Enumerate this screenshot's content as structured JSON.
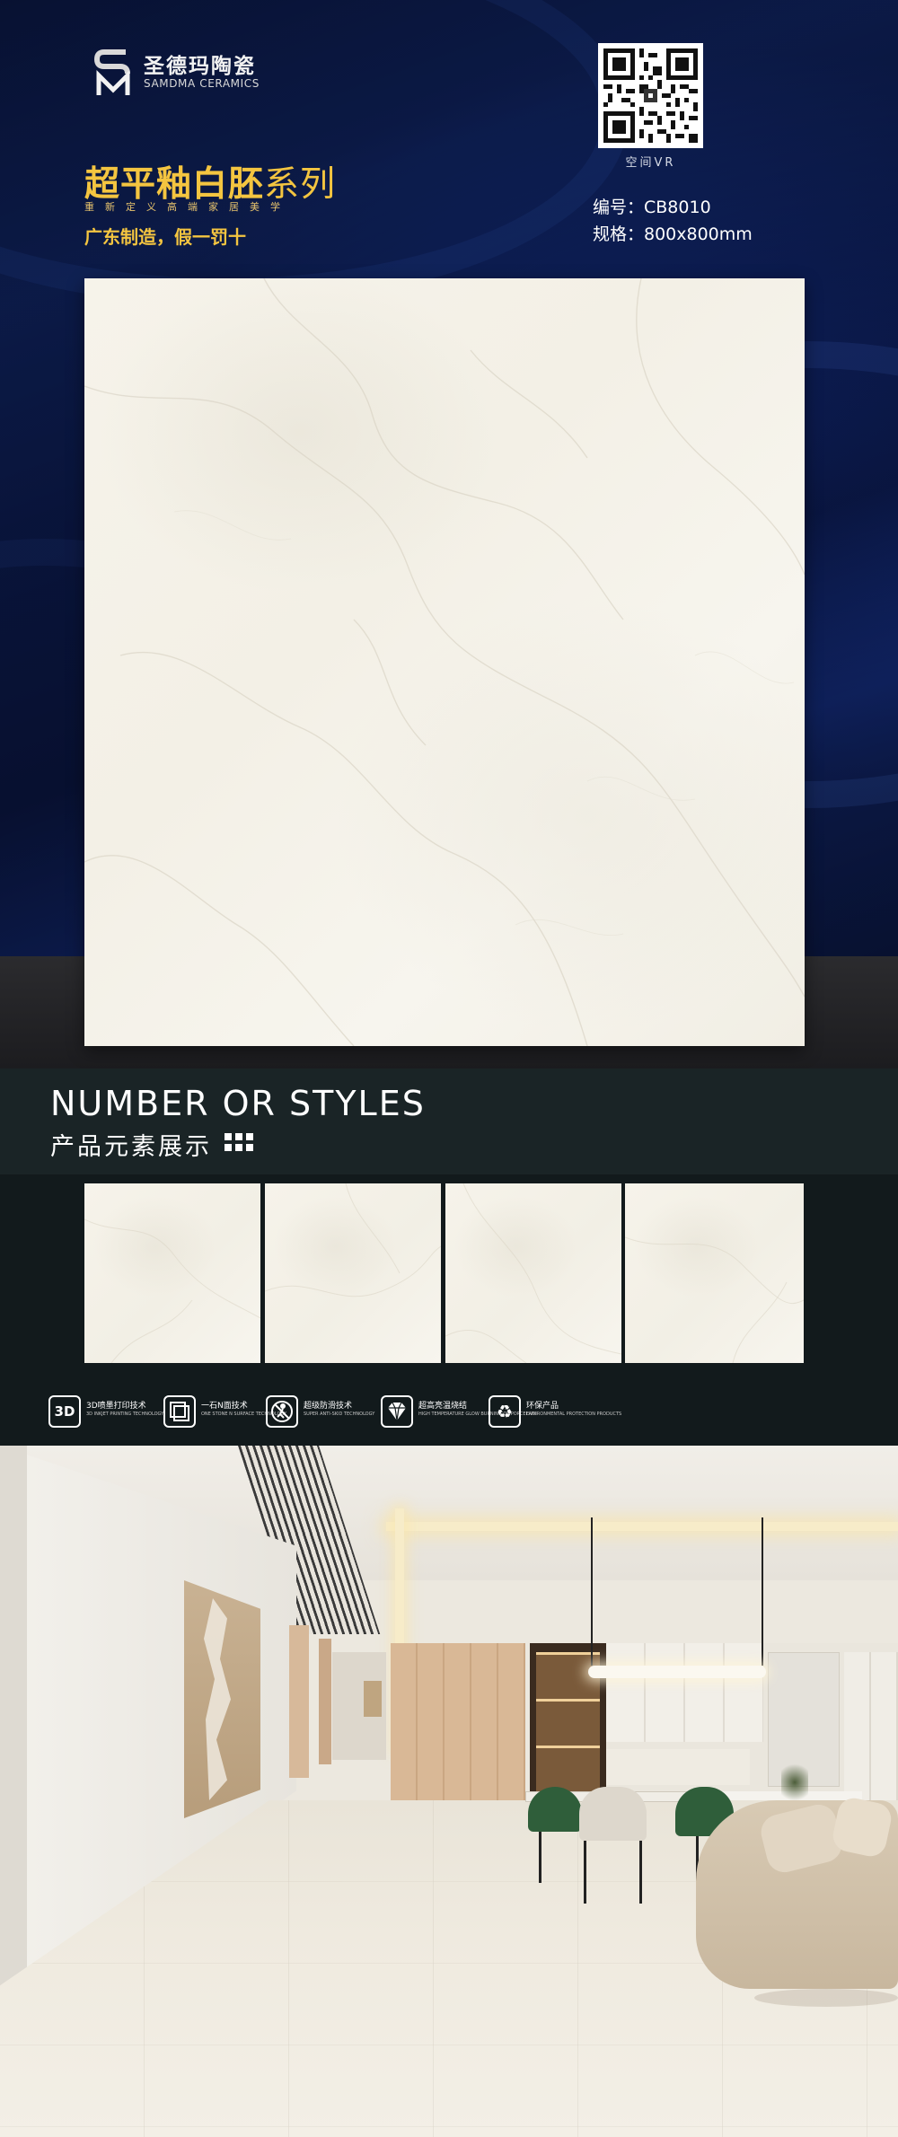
{
  "brand": {
    "name_cn": "圣德玛陶瓷",
    "name_en": "SAMDMA CERAMICS"
  },
  "hero": {
    "series_title_bold": "超平釉白胚",
    "series_title_light": "系列",
    "series_subtitle": "重新定义高端家居美学",
    "made_in": "广东制造，假一罚十",
    "qr_caption": "空间VR",
    "code": "编号：CB8010",
    "size": "规格：800x800mm"
  },
  "styles_section": {
    "title_en": "NUMBER OR STYLES",
    "title_cn": "产品元素展示"
  },
  "technologies": [
    {
      "icon": "3d-icon",
      "icon_text": "3D",
      "cn": "3D喷墨打印技术",
      "en": "3D INKJET PRINTING TECHNOLOGY"
    },
    {
      "icon": "layers-icon",
      "icon_text": "",
      "cn": "一石N面技术",
      "en": "ONE STONE N SURFACE TECHNOLOGY"
    },
    {
      "icon": "anti-slip-icon",
      "icon_text": "",
      "cn": "超级防滑技术",
      "en": "SUPER ANTI-SKID TECHNOLOGY"
    },
    {
      "icon": "diamond-icon",
      "icon_text": "",
      "cn": "超高亮温烧结",
      "en": "HIGH TEMPERATURE GLOW BURNING OF PORCELAIN"
    },
    {
      "icon": "recycle-icon",
      "icon_text": "",
      "cn": "环保产品",
      "en": "ENVIRONMENTAL PROTECTION PRODUCTS"
    }
  ],
  "colors": {
    "gold": "#f4c540",
    "navy": "#0d1f5a",
    "dark_band": "#121a1c",
    "tile": "#f6f3ea"
  }
}
